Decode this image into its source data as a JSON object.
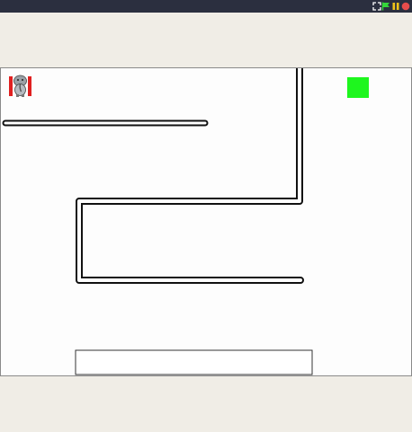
{
  "window": {
    "controls": [
      {
        "name": "fullscreen-icon",
        "color": "#ffffff"
      },
      {
        "name": "green-flag-icon",
        "color": "#35d63a"
      },
      {
        "name": "pause-icon",
        "color": "#f0c419"
      },
      {
        "name": "stop-icon",
        "color": "#e74c4c"
      }
    ]
  },
  "stage": {
    "background": "#fdfdfd",
    "player_sprite": "elephant-sprite",
    "goal": {
      "color": "#1ef61e"
    },
    "wall_color": "#111111",
    "platform": {
      "color": "#ffffff",
      "border": "#333333"
    }
  }
}
